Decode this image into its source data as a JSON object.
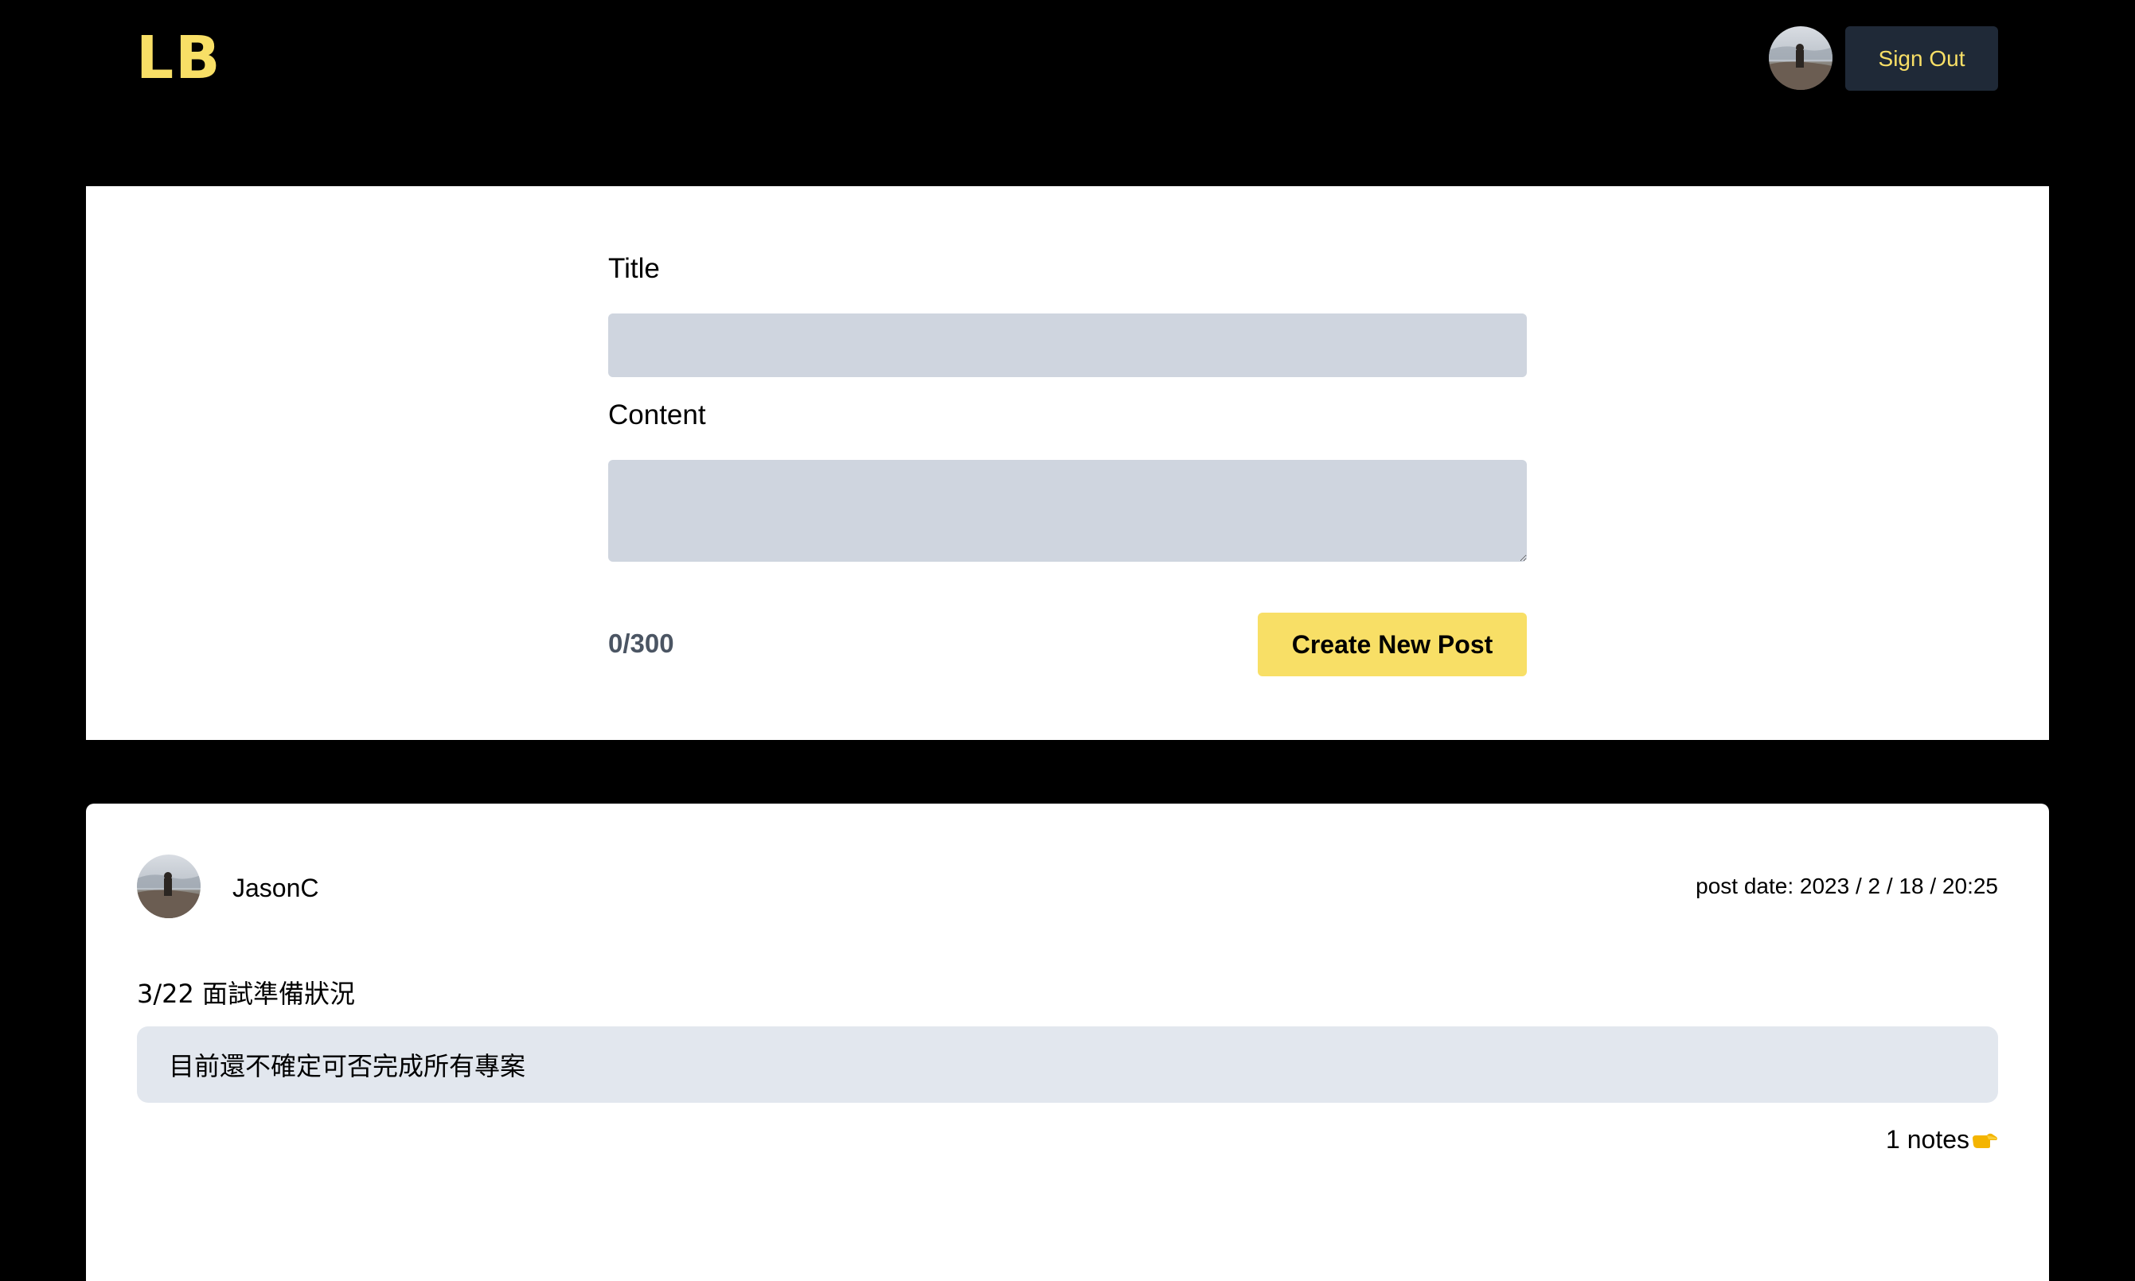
{
  "header": {
    "logo": "LB",
    "sign_out_label": "Sign Out"
  },
  "composer": {
    "title_label": "Title",
    "title_value": "",
    "content_label": "Content",
    "content_value": "",
    "char_count": "0/300",
    "create_label": "Create New Post"
  },
  "posts": [
    {
      "author": "JasonC",
      "date": "post date: 2023 / 2 / 18 / 20:25",
      "title": "3/22 面試準備狀況",
      "content": "目前還不確定可否完成所有專案",
      "notes": "1 notes"
    }
  ],
  "icons": {
    "avatar": "user-photo-avatar",
    "notes_pointer": "pointing-hand-icon"
  },
  "colors": {
    "accent_yellow": "#f8df66",
    "page_background": "#000000",
    "card_background": "#ffffff",
    "input_background": "#cfd5df",
    "post_body_background": "#e2e7ee",
    "signout_background": "#1f2937",
    "counter_text": "#4b5563"
  }
}
